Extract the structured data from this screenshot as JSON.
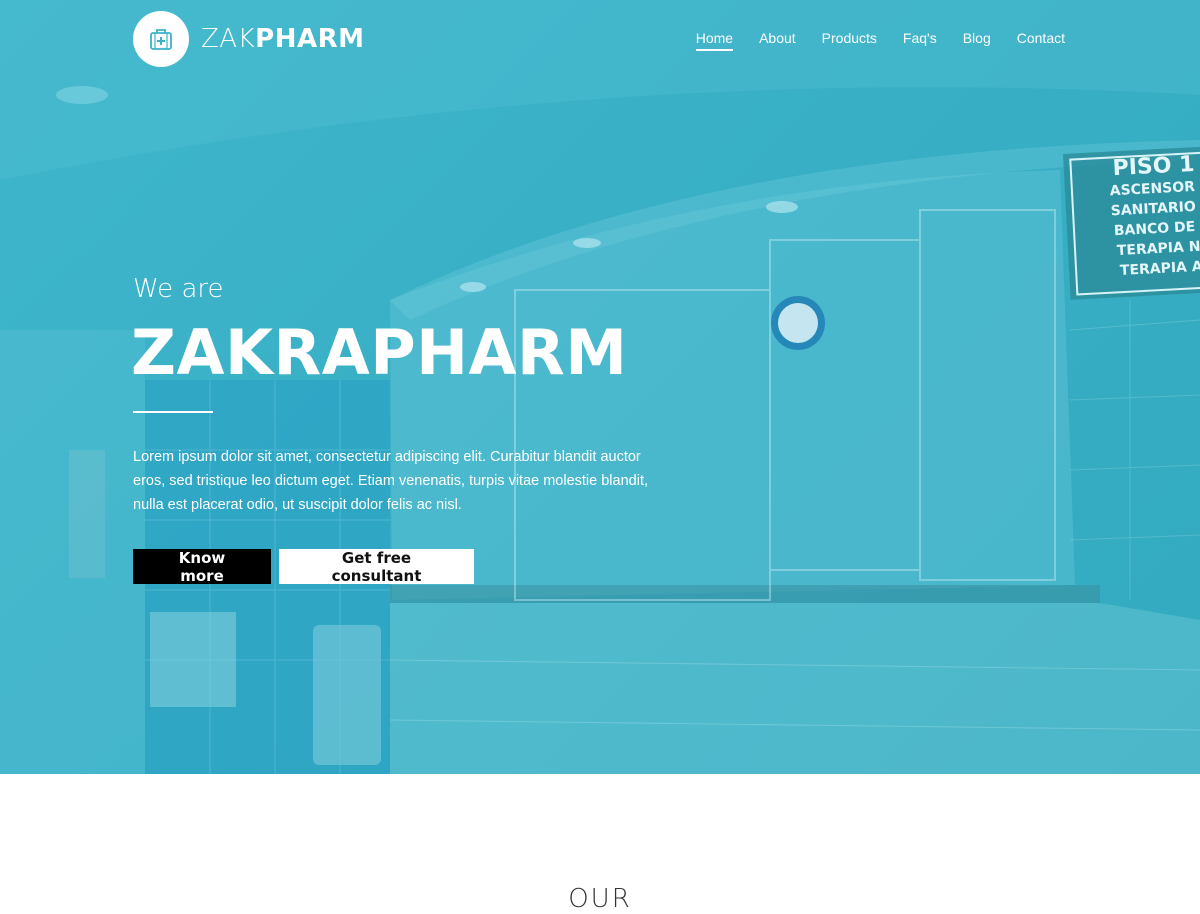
{
  "brand": {
    "name_light": "ZAK",
    "name_bold": "PHARM",
    "logo_icon": "medical-kit-icon"
  },
  "nav": {
    "items": [
      {
        "label": "Home",
        "active": true
      },
      {
        "label": "About",
        "active": false
      },
      {
        "label": "Products",
        "active": false
      },
      {
        "label": "Faq's",
        "active": false
      },
      {
        "label": "Blog",
        "active": false
      },
      {
        "label": "Contact",
        "active": false
      }
    ]
  },
  "hero": {
    "intro": "We are",
    "title": "ZAKRAPHARM",
    "description": "Lorem ipsum dolor sit amet, consectetur adipiscing elit. Curabitur blandit auctor eros, sed tristique leo dictum eget. Etiam venenatis, turpis vitae molestie blandit, nulla est placerat odio, ut suscipit dolor felis ac nisl.",
    "primary_button": "Know more",
    "secondary_button": "Get free consultant"
  },
  "background_sign": {
    "heading": "PISO 1",
    "lines": [
      "ASCENSOR",
      "SANITARIO",
      "BANCO DE SA",
      "TERAPIA NEO",
      "TERAPIA ADU"
    ]
  },
  "next_section": {
    "heading": "OUR"
  },
  "colors": {
    "hero_overlay": "#3ab3c9",
    "primary_button_bg": "#000000",
    "secondary_button_bg": "#ffffff",
    "text_on_hero": "#ffffff"
  }
}
